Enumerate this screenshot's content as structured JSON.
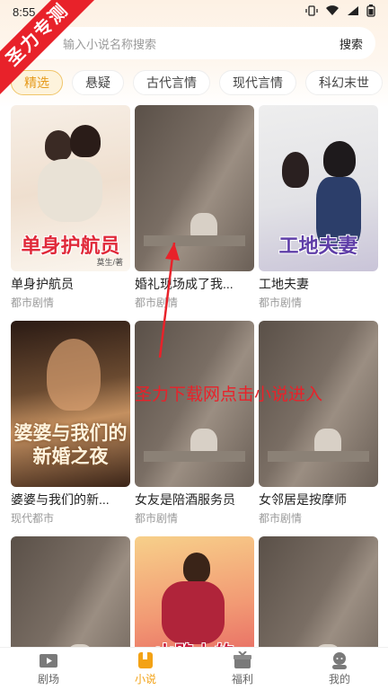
{
  "status_bar": {
    "time": "8:55"
  },
  "watermark": "圣力专测",
  "search": {
    "placeholder": "输入小说名称搜索",
    "button_label": "搜索"
  },
  "tabs": [
    {
      "label": "精选",
      "active": true
    },
    {
      "label": "悬疑",
      "active": false
    },
    {
      "label": "古代言情",
      "active": false
    },
    {
      "label": "现代言情",
      "active": false
    },
    {
      "label": "科幻末世",
      "active": false
    }
  ],
  "books": [
    {
      "title": "单身护航员",
      "genre": "都市剧情",
      "cover_text": "单身护航员",
      "cover_author": "莫生/著"
    },
    {
      "title": "婚礼现场成了我...",
      "genre": "都市剧情",
      "cover_text": "",
      "cover_author": ""
    },
    {
      "title": "工地夫妻",
      "genre": "都市剧情",
      "cover_text": "工地夫妻",
      "cover_author": ""
    },
    {
      "title": "婆婆与我们的新...",
      "genre": "现代都市",
      "cover_text": "婆婆与我们的新婚之夜",
      "cover_author": ""
    },
    {
      "title": "女友是陪酒服务员",
      "genre": "都市剧情",
      "cover_text": "",
      "cover_author": ""
    },
    {
      "title": "女邻居是按摩师",
      "genre": "都市剧情",
      "cover_text": "",
      "cover_author": ""
    },
    {
      "title": "",
      "genre": "",
      "cover_text": "",
      "cover_author": ""
    },
    {
      "title": "",
      "genre": "",
      "cover_text": "山路上的",
      "cover_author": ""
    },
    {
      "title": "",
      "genre": "",
      "cover_text": "",
      "cover_author": ""
    }
  ],
  "annotation": "圣力下载网点击小说进入",
  "bottom_nav": [
    {
      "label": "剧场",
      "icon": "theater-icon",
      "active": false
    },
    {
      "label": "小说",
      "icon": "book-icon",
      "active": true
    },
    {
      "label": "福利",
      "icon": "gift-icon",
      "active": false
    },
    {
      "label": "我的",
      "icon": "profile-icon",
      "active": false
    }
  ],
  "colors": {
    "accent": "#f3a215",
    "watermark_red": "#e8222a"
  }
}
